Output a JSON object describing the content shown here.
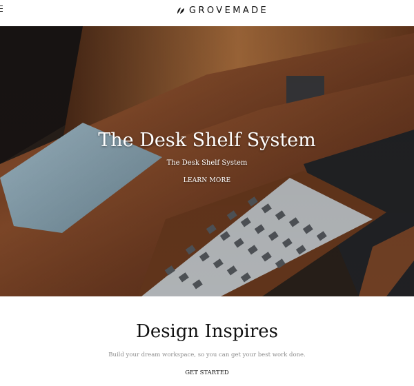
{
  "header": {
    "brand": "GROVEMADE",
    "menu_icon": "hamburger-menu-icon",
    "logo_icon": "leaf-logo-icon"
  },
  "hero": {
    "title": "The Desk Shelf System",
    "subtitle": "The Desk Shelf System",
    "cta": "LEARN MORE"
  },
  "section": {
    "title": "Design Inspires",
    "text": "Build your dream workspace, so you can get your best work done.",
    "cta": "GET STARTED"
  },
  "colors": {
    "text": "#111111",
    "muted": "#8c8c8c",
    "walnut": "#7a4527",
    "background": "#ffffff"
  }
}
